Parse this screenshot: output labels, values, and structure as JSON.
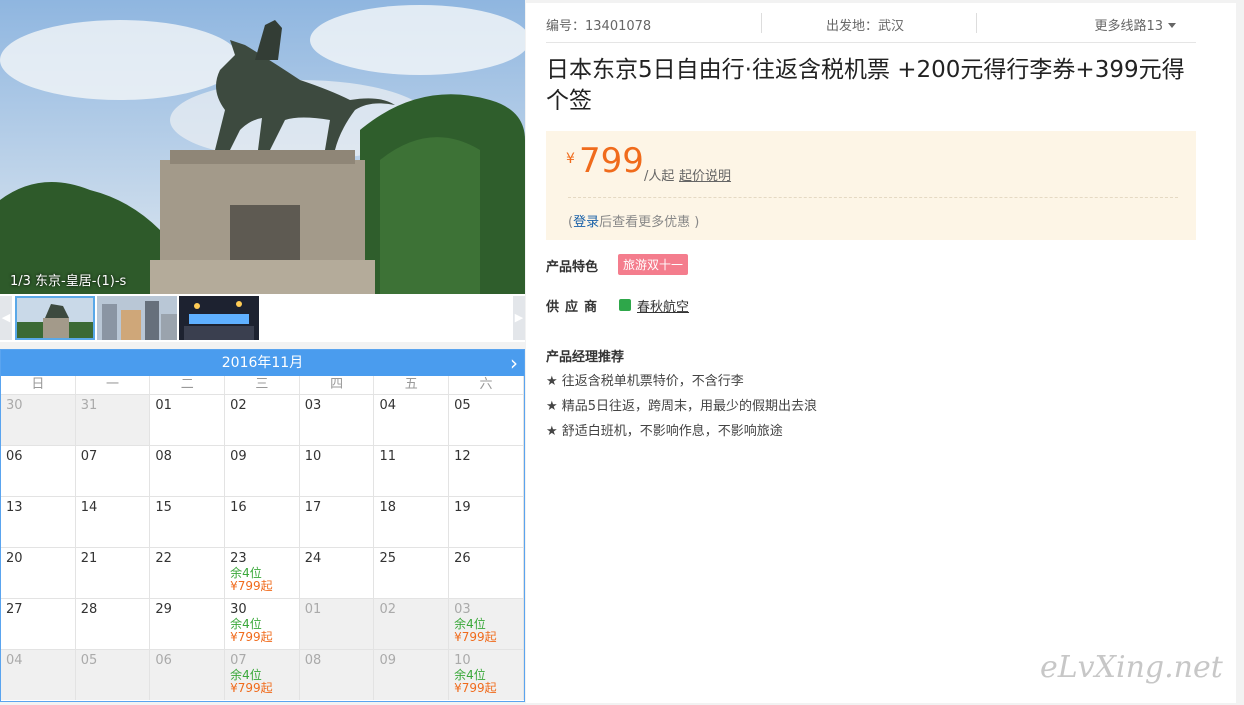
{
  "photo": {
    "caption": "1/3 东京-皇居-(1)-s"
  },
  "calendar": {
    "month_label": "2016年11月",
    "next_icon": "chevron-right-icon",
    "weekdays": [
      "日",
      "一",
      "二",
      "三",
      "四",
      "五",
      "六"
    ],
    "days": [
      {
        "d": "30",
        "dim": true
      },
      {
        "d": "31",
        "dim": true
      },
      {
        "d": "01"
      },
      {
        "d": "02"
      },
      {
        "d": "03"
      },
      {
        "d": "04"
      },
      {
        "d": "05"
      },
      {
        "d": "06"
      },
      {
        "d": "07"
      },
      {
        "d": "08"
      },
      {
        "d": "09"
      },
      {
        "d": "10"
      },
      {
        "d": "11"
      },
      {
        "d": "12"
      },
      {
        "d": "13"
      },
      {
        "d": "14"
      },
      {
        "d": "15"
      },
      {
        "d": "16"
      },
      {
        "d": "17"
      },
      {
        "d": "18"
      },
      {
        "d": "19"
      },
      {
        "d": "20"
      },
      {
        "d": "21"
      },
      {
        "d": "22"
      },
      {
        "d": "23",
        "seats": "余4位",
        "price": "¥799起"
      },
      {
        "d": "24"
      },
      {
        "d": "25"
      },
      {
        "d": "26"
      },
      {
        "d": "27"
      },
      {
        "d": "28"
      },
      {
        "d": "29"
      },
      {
        "d": "30",
        "seats": "余4位",
        "price": "¥799起"
      },
      {
        "d": "01",
        "dim": true
      },
      {
        "d": "02",
        "dim": true
      },
      {
        "d": "03",
        "dim": true,
        "seats": "余4位",
        "price": "¥799起"
      },
      {
        "d": "04",
        "dim": true
      },
      {
        "d": "05",
        "dim": true
      },
      {
        "d": "06",
        "dim": true
      },
      {
        "d": "07",
        "dim": true,
        "seats": "余4位",
        "price": "¥799起"
      },
      {
        "d": "08",
        "dim": true
      },
      {
        "d": "09",
        "dim": true
      },
      {
        "d": "10",
        "dim": true,
        "seats": "余4位",
        "price": "¥799起"
      }
    ]
  },
  "meta": {
    "id_label": "编号：13401078",
    "depart_label": "出发地：武汉",
    "more_routes": "更多线路13"
  },
  "product": {
    "title": "日本东京5日自由行·往返含税机票 +200元得行李券+399元得个签",
    "currency": "¥",
    "price": "799",
    "unit": "/人起",
    "price_explain": "起价说明",
    "login_prefix": "(",
    "login_link": "登录",
    "login_suffix": "后查看更多优惠 )"
  },
  "feature": {
    "label": "产品特色",
    "tag": "旅游双十一"
  },
  "supplier": {
    "label": "供应商",
    "name": "春秋航空"
  },
  "recommend": {
    "title": "产品经理推荐",
    "items": [
      "★ 往返含税单机票特价，不含行李",
      "★ 精品5日往返，跨周末，用最少的假期出去浪",
      "★ 舒适白班机，不影响作息，不影响旅途"
    ]
  },
  "watermark": "eLvXing.net",
  "colors": {
    "accent_blue": "#4a9cee",
    "price_orange": "#f06b1c",
    "seats_green": "#3aa83a",
    "tag_pink": "#f47d8d"
  }
}
